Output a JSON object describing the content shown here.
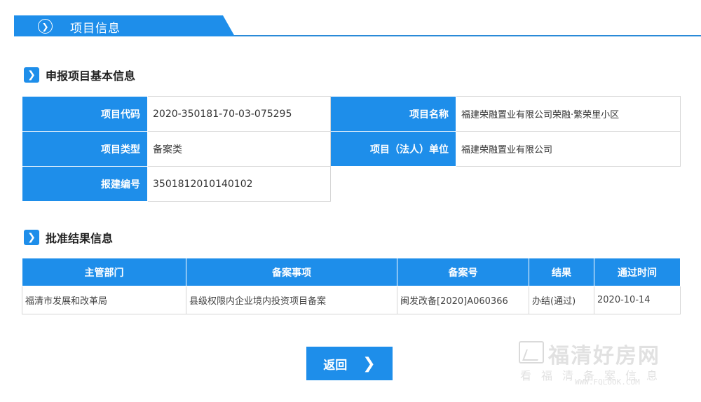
{
  "header": {
    "title": "项目信息",
    "icon": "chevron-right-circle-icon"
  },
  "basic_section": {
    "title": "申报项目基本信息",
    "fields": {
      "project_code": {
        "label": "项目代码",
        "value": "2020-350181-70-03-075295"
      },
      "project_name": {
        "label": "项目名称",
        "value": "福建荣融置业有限公司荣融·繁荣里小区"
      },
      "project_type": {
        "label": "项目类型",
        "value": "备案类"
      },
      "legal_unit": {
        "label": "项目（法人）单位",
        "value": "福建荣融置业有限公司"
      },
      "report_number": {
        "label": "报建编号",
        "value": "3501812010140102"
      }
    }
  },
  "approval_section": {
    "title": "批准结果信息",
    "columns": [
      "主管部门",
      "备案事项",
      "备案号",
      "结果",
      "通过时间"
    ],
    "rows": [
      [
        "福清市发展和改革局",
        "县级权限内企业境内投资项目备案",
        "闽发改备[2020]A060366",
        "办结(通过)",
        "2020-10-14"
      ]
    ]
  },
  "back_button": {
    "label": "返回",
    "icon": "chevron-right-icon"
  },
  "watermark": {
    "name": "福清好房网",
    "slogan": "看福清备案信息",
    "url": "WWW.FQLOOK.COM"
  },
  "colors": {
    "accent": "#1e8eea",
    "border": "#d6d6d6"
  }
}
